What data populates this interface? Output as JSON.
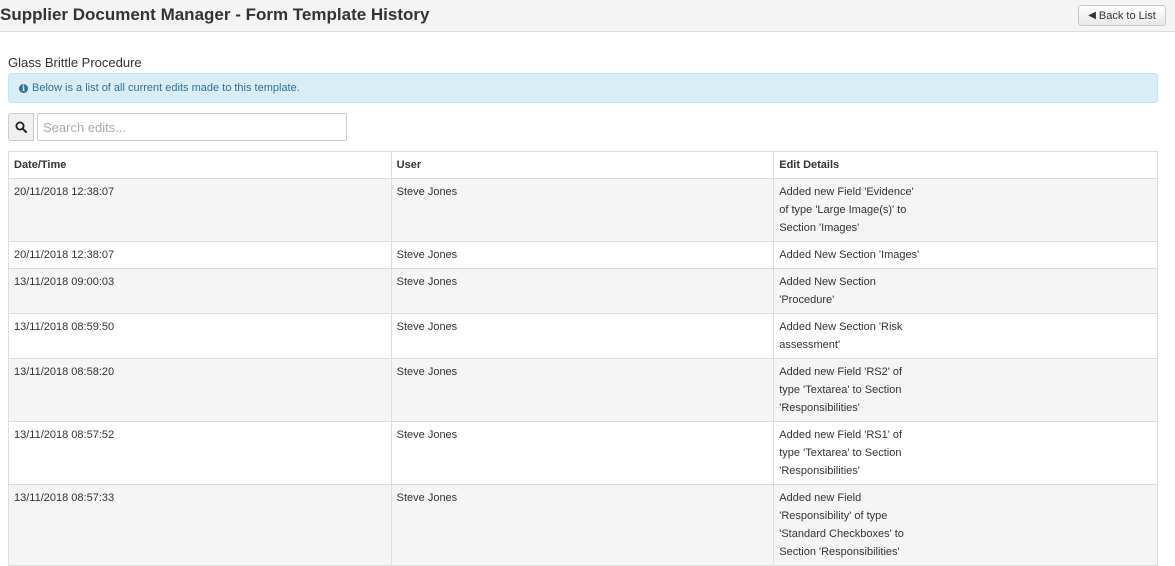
{
  "header": {
    "title": "Supplier Document Manager - Form Template History",
    "back_label": "Back to List"
  },
  "template": {
    "name": "Glass Brittle Procedure"
  },
  "info_alert": {
    "text": "Below is a list of all current edits made to this template."
  },
  "search": {
    "placeholder": "Search edits...",
    "value": ""
  },
  "table": {
    "columns": [
      "Date/Time",
      "User",
      "Edit Details"
    ],
    "rows": [
      {
        "datetime": "20/11/2018 12:38:07",
        "user": "Steve Jones",
        "details": "Added new Field 'Evidence' of type 'Large Image(s)' to Section 'Images'"
      },
      {
        "datetime": "20/11/2018 12:38:07",
        "user": "Steve Jones",
        "details": "Added New Section 'Images'"
      },
      {
        "datetime": "13/11/2018 09:00:03",
        "user": "Steve Jones",
        "details": "Added New Section 'Procedure'"
      },
      {
        "datetime": "13/11/2018 08:59:50",
        "user": "Steve Jones",
        "details": "Added New Section 'Risk assessment'"
      },
      {
        "datetime": "13/11/2018 08:58:20",
        "user": "Steve Jones",
        "details": "Added new Field 'RS2' of type 'Textarea' to Section 'Responsibilities'"
      },
      {
        "datetime": "13/11/2018 08:57:52",
        "user": "Steve Jones",
        "details": "Added new Field 'RS1' of type 'Textarea' to Section 'Responsibilities'"
      },
      {
        "datetime": "13/11/2018 08:57:33",
        "user": "Steve Jones",
        "details": "Added new Field 'Responsibility' of type 'Standard Checkboxes' to Section 'Responsibilities'"
      }
    ]
  },
  "icons": {
    "back": "arrow-left-icon",
    "info": "info-circle-icon",
    "search": "magnifier-icon"
  },
  "colors": {
    "alert_bg": "#d9edf7",
    "alert_text": "#31708f",
    "row_stripe": "#f5f5f5"
  }
}
